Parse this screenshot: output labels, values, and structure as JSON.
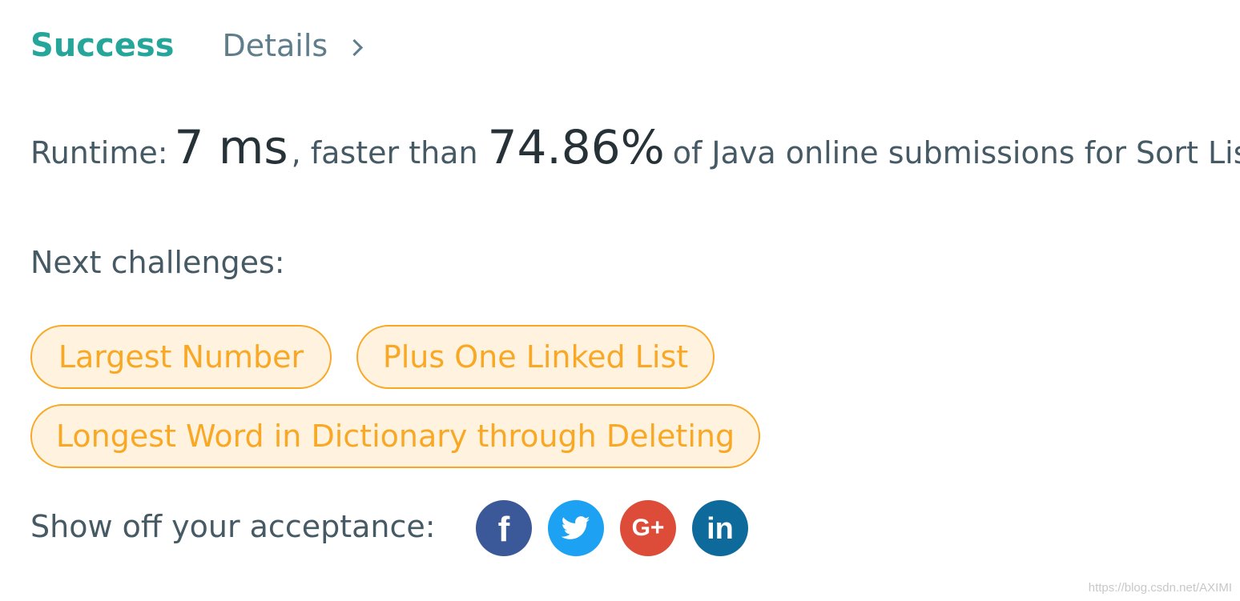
{
  "header": {
    "status": "Success",
    "details_label": "Details"
  },
  "runtime": {
    "prefix": "Runtime:",
    "value": "7 ms",
    "middle": ", faster than",
    "percentile": "74.86%",
    "suffix": "of Java online submissions for Sort List."
  },
  "next": {
    "label": "Next challenges:",
    "challenges": [
      {
        "label": "Largest Number"
      },
      {
        "label": "Plus One Linked List"
      },
      {
        "label": "Longest Word in Dictionary through Deleting"
      }
    ]
  },
  "share": {
    "label": "Show off your acceptance:",
    "icons": {
      "facebook": {
        "glyph": "f",
        "color": "#3b5998"
      },
      "twitter": {
        "glyph": "twitter-bird",
        "color": "#1da1f2"
      },
      "google_plus": {
        "glyph": "G+",
        "color": "#dd4b39"
      },
      "linkedin": {
        "glyph": "in",
        "color": "#0e6a9b"
      }
    }
  },
  "watermark": "https://blog.csdn.net/AXIMI",
  "colors": {
    "success": "#26a69a",
    "chip_border": "#f9a825",
    "chip_bg": "#fff3e0",
    "text": "#455a64"
  }
}
